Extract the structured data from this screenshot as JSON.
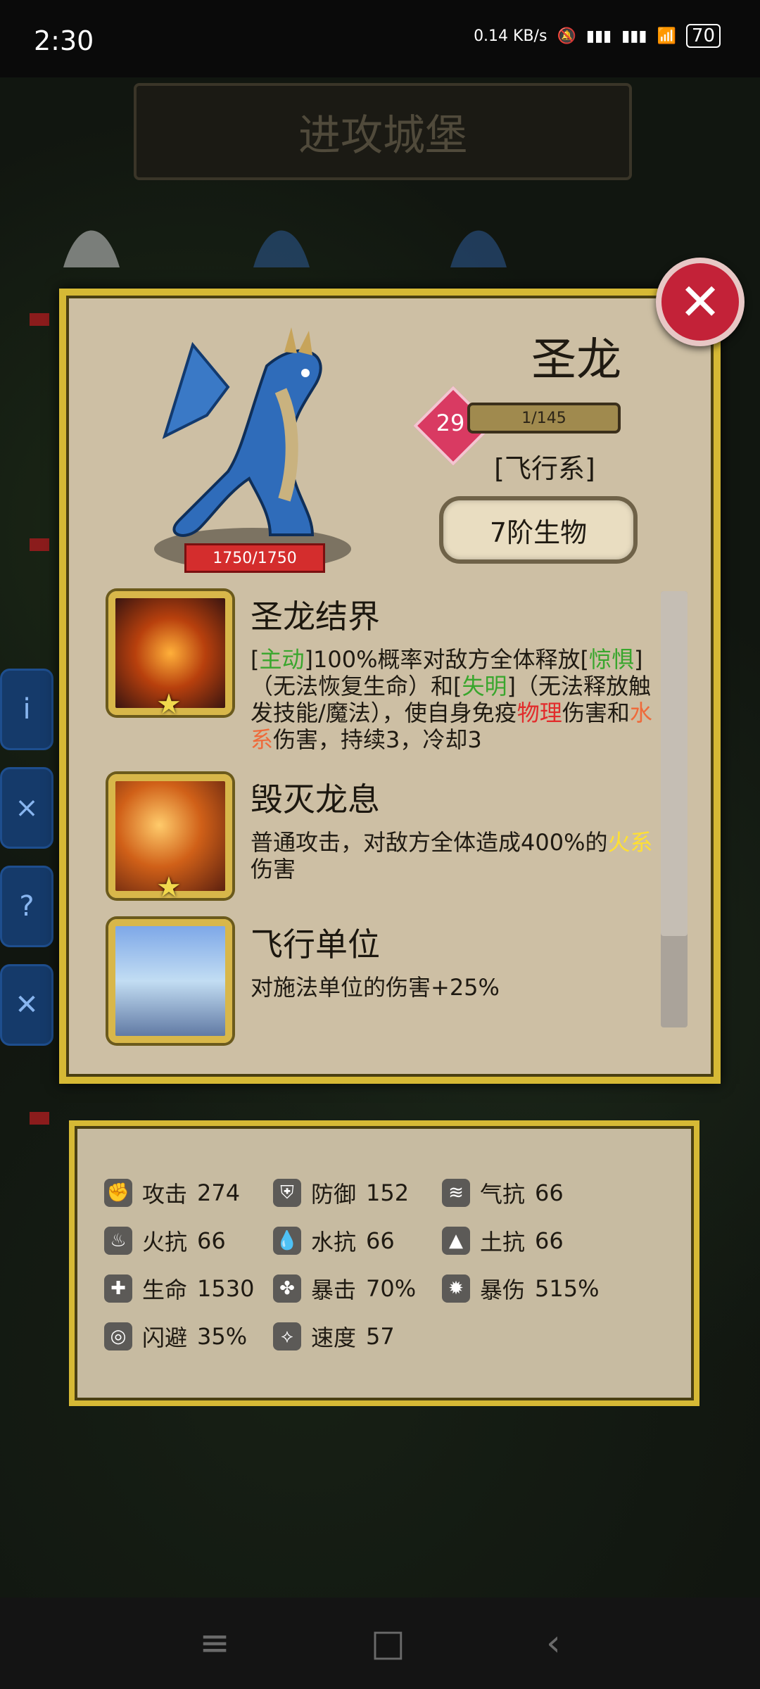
{
  "status": {
    "time": "2:30",
    "net": "0.14 KB/s",
    "battery": "70"
  },
  "game": {
    "screen_title": "进攻城堡"
  },
  "unit": {
    "name": "圣龙",
    "level": "29",
    "xp": "1/145",
    "type": "[飞行系]",
    "rank": "7阶生物",
    "hp": "1750/1750"
  },
  "skills": [
    {
      "name": "圣龙结界",
      "desc_parts": [
        {
          "text": "[",
          "color": ""
        },
        {
          "text": "主动",
          "color": "green"
        },
        {
          "text": "]100%概率对敌方全体释放",
          "color": ""
        },
        {
          "text": "[",
          "color": ""
        },
        {
          "text": "惊惧",
          "color": "green"
        },
        {
          "text": "]（无法恢复生命）和[",
          "color": ""
        },
        {
          "text": "失明",
          "color": "green"
        },
        {
          "text": "]（无法释放触发技能/魔法），使自身免疫",
          "color": ""
        },
        {
          "text": "物理",
          "color": "red"
        },
        {
          "text": "伤害和",
          "color": ""
        },
        {
          "text": "水系",
          "color": "orange"
        },
        {
          "text": "伤害，持续3，冷却3",
          "color": ""
        }
      ]
    },
    {
      "name": "毁灭龙息",
      "desc_parts": [
        {
          "text": "普通攻击，对敌方全体造成400%的",
          "color": ""
        },
        {
          "text": "火系",
          "color": "yellow"
        },
        {
          "text": "伤害",
          "color": ""
        }
      ]
    },
    {
      "name": "飞行单位",
      "desc_parts": [
        {
          "text": "对施法单位的伤害+25%",
          "color": ""
        }
      ]
    }
  ],
  "stats": [
    {
      "label": "攻击",
      "value": "274",
      "icon": "fist-icon"
    },
    {
      "label": "防御",
      "value": "152",
      "icon": "shield-icon"
    },
    {
      "label": "气抗",
      "value": "66",
      "icon": "tornado-icon"
    },
    {
      "label": "火抗",
      "value": "66",
      "icon": "fire-icon"
    },
    {
      "label": "水抗",
      "value": "66",
      "icon": "water-drop-icon"
    },
    {
      "label": "土抗",
      "value": "66",
      "icon": "mountain-icon"
    },
    {
      "label": "生命",
      "value": "1530",
      "icon": "heart-plus-icon"
    },
    {
      "label": "暴击",
      "value": "70%",
      "icon": "clover-icon"
    },
    {
      "label": "暴伤",
      "value": "515%",
      "icon": "burst-icon"
    },
    {
      "label": "闪避",
      "value": "35%",
      "icon": "dodge-icon"
    },
    {
      "label": "速度",
      "value": "57",
      "icon": "boot-icon"
    }
  ]
}
